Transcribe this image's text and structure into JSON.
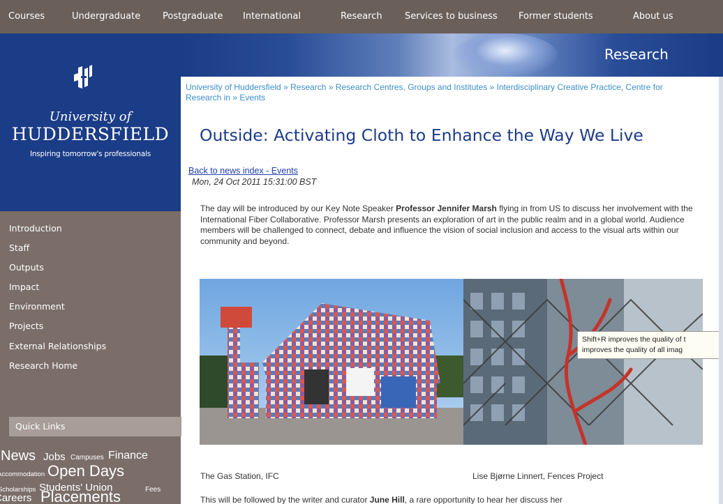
{
  "top_nav": [
    "Courses",
    "Undergraduate",
    "Postgraduate",
    "International",
    "Research",
    "Services to business",
    "Former students",
    "About us"
  ],
  "brand": {
    "university_of": "University of",
    "name": "HUDDERSFIELD",
    "tagline": "Inspiring tomorrow's professionals"
  },
  "left_menu": [
    "Introduction",
    "Staff",
    "Outputs",
    "Impact",
    "Environment",
    "Projects",
    "External Relationships",
    "Research Home"
  ],
  "quick_links": {
    "title": "Quick Links",
    "tags": [
      {
        "text": "News"
      },
      {
        "text": "Jobs"
      },
      {
        "text": "Campuses"
      },
      {
        "text": "Finance"
      },
      {
        "text": "Accommodation"
      },
      {
        "text": "Open Days"
      },
      {
        "text": "Scholarships"
      },
      {
        "text": "Students' Union"
      },
      {
        "text": "Fees"
      },
      {
        "text": "Careers"
      },
      {
        "text": "Placements"
      }
    ]
  },
  "banner": {
    "title": "Research"
  },
  "breadcrumb": {
    "items": [
      "University of Huddersfield",
      "Research",
      "Research Centres, Groups and Institutes",
      "Interdisciplinary Creative Practice, Centre for Research in",
      "Events"
    ],
    "separator": "»"
  },
  "article": {
    "title": "Outside: Activating Cloth to Enhance the Way We Live",
    "back_link": "Back to news index - Events",
    "date": "Mon, 24 Oct 2011 15:31:00 BST",
    "intro_before": "The day will be introduced by our Key Note Speaker ",
    "intro_bold": "Professor Jennifer Marsh",
    "intro_after": " flying in from US to discuss her involvement with the International Fiber Collaborative. Professor Marsh presents an exploration of art in the public realm and in a global world. Audience members will be challenged to connect, debate and influence the vision of social inclusion and access to the visual arts within our community and beyond.",
    "caption_left": "The Gas Station, IFC",
    "caption_right": "Lise Bjørne Linnert, Fences Project",
    "para2_before": "This will be followed by the writer and curator ",
    "para2_bold": "June Hill",
    "para2_after": ", a rare opportunity to hear her discuss her"
  },
  "tooltip": {
    "line1": "Shift+R improves the quality of t",
    "line2": "improves the quality of all imag"
  },
  "colors": {
    "nav_bg": "#6b5f59",
    "brand_blue": "#1b3c87",
    "menu_bg": "#7b6e69",
    "link": "#3b8fc7",
    "title": "#1b3c87"
  }
}
